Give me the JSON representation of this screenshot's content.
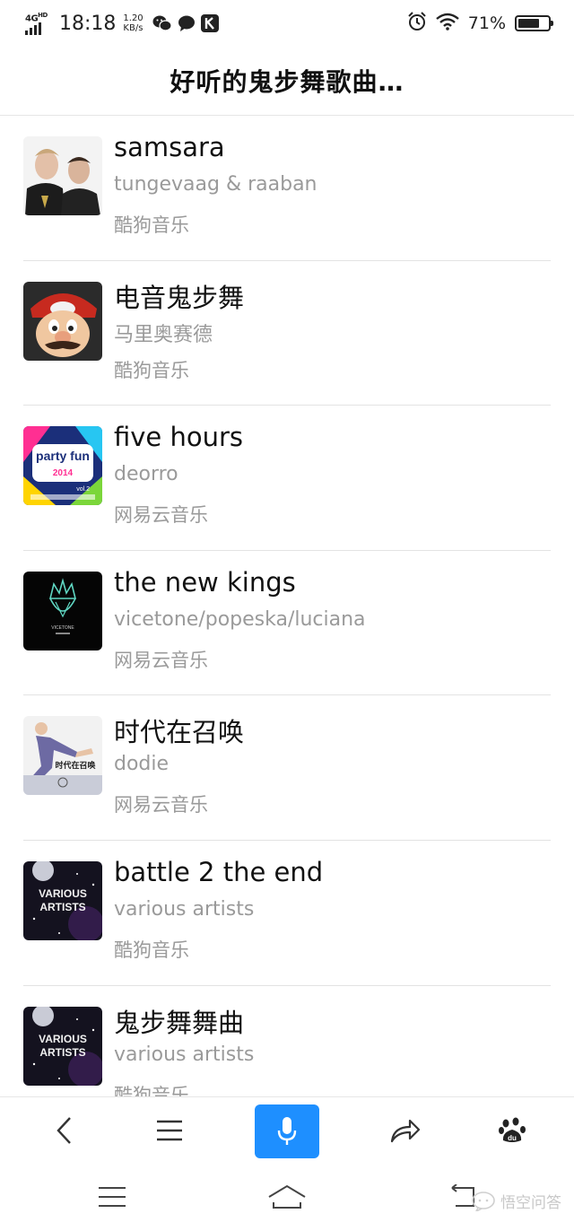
{
  "status_bar": {
    "network": "4G",
    "network_sup": "HD",
    "time": "18:18",
    "speed_value": "1.20",
    "speed_unit": "KB/s",
    "battery": "71%",
    "battery_level": 0.71,
    "icons": [
      "wechat-icon",
      "chat-bubble-icon",
      "k-app-icon",
      "alarm-icon",
      "wifi-icon"
    ]
  },
  "header": {
    "title": "好听的鬼步舞歌曲…"
  },
  "songs": [
    {
      "title": "samsara",
      "artist": "tungevaag & raaban",
      "source": "酷狗音乐"
    },
    {
      "title": "电音鬼步舞",
      "artist": "马里奥赛德",
      "source": "酷狗音乐"
    },
    {
      "title": "five hours",
      "artist": "deorro",
      "source": "网易云音乐"
    },
    {
      "title": "the new kings",
      "artist": "vicetone/popeska/luciana",
      "source": "网易云音乐"
    },
    {
      "title": "时代在召唤",
      "artist": "dodie",
      "source": "网易云音乐"
    },
    {
      "title": "battle 2 the end",
      "artist": "various artists",
      "source": "酷狗音乐"
    },
    {
      "title": "鬼步舞舞曲",
      "artist": "various artists",
      "source": "酷狗音乐"
    }
  ],
  "covers": {
    "cover_3_text": "party fun",
    "cover_3_sub": "2014",
    "cover_3_vol": "vol.2",
    "cover_4_text": "VICETONE",
    "cover_5_text": "时代在召唤",
    "cover_6_line1": "VARIOUS",
    "cover_6_line2": "ARTISTS",
    "cover_7_line1": "VARIOUS",
    "cover_7_line2": "ARTISTS"
  },
  "toolbar": {
    "buttons": [
      "back-icon",
      "menu-icon",
      "microphone-icon",
      "share-icon",
      "baidu-paw-icon"
    ],
    "accent": "#1e8fff"
  },
  "system_nav": {
    "buttons": [
      "menu-icon",
      "home-icon",
      "back-return-icon"
    ],
    "watermark": "悟空问答"
  }
}
